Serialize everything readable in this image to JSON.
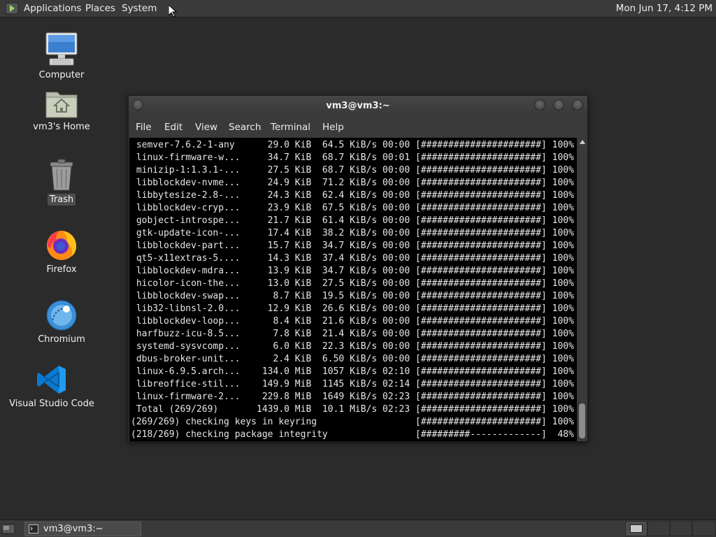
{
  "top_panel": {
    "menus": [
      "Applications",
      "Places",
      "System"
    ],
    "clock": "Mon Jun 17,  4:12 PM"
  },
  "desktop_icons": [
    {
      "label": "Computer"
    },
    {
      "label": "vm3's Home"
    },
    {
      "label": "Trash"
    },
    {
      "label": "Firefox"
    },
    {
      "label": "Chromium"
    },
    {
      "label": "Visual Studio Code"
    }
  ],
  "terminal": {
    "title": "vm3@vm3:~",
    "menu": [
      "File",
      "Edit",
      "View",
      "Search",
      "Terminal",
      "Help"
    ],
    "lines": [
      " semver-7.6.2-1-any      29.0 KiB  64.5 KiB/s 00:00 [######################] 100%",
      " linux-firmware-w...     34.7 KiB  68.7 KiB/s 00:01 [######################] 100%",
      " minizip-1:1.3.1-...     27.5 KiB  68.7 KiB/s 00:00 [######################] 100%",
      " libblockdev-nvme...     24.9 KiB  71.2 KiB/s 00:00 [######################] 100%",
      " libbytesize-2.8-...     24.3 KiB  62.4 KiB/s 00:00 [######################] 100%",
      " libblockdev-cryp...     23.9 KiB  67.5 KiB/s 00:00 [######################] 100%",
      " gobject-introspe...     21.7 KiB  61.4 KiB/s 00:00 [######################] 100%",
      " gtk-update-icon-...     17.4 KiB  38.2 KiB/s 00:00 [######################] 100%",
      " libblockdev-part...     15.7 KiB  34.7 KiB/s 00:00 [######################] 100%",
      " qt5-x11extras-5....     14.3 KiB  37.4 KiB/s 00:00 [######################] 100%",
      " libblockdev-mdra...     13.9 KiB  34.7 KiB/s 00:00 [######################] 100%",
      " hicolor-icon-the...     13.0 KiB  27.5 KiB/s 00:00 [######################] 100%",
      " libblockdev-swap...      8.7 KiB  19.5 KiB/s 00:00 [######################] 100%",
      " lib32-libnsl-2.0...     12.9 KiB  26.6 KiB/s 00:00 [######################] 100%",
      " libblockdev-loop...      8.4 KiB  21.6 KiB/s 00:00 [######################] 100%",
      " harfbuzz-icu-8.5...      7.8 KiB  21.4 KiB/s 00:00 [######################] 100%",
      " systemd-sysvcomp...      6.0 KiB  22.3 KiB/s 00:00 [######################] 100%",
      " dbus-broker-unit...      2.4 KiB  6.50 KiB/s 00:00 [######################] 100%",
      " linux-6.9.5.arch...    134.0 MiB  1057 KiB/s 02:10 [######################] 100%",
      " libreoffice-stil...    149.9 MiB  1145 KiB/s 02:14 [######################] 100%",
      " linux-firmware-2...    229.8 MiB  1649 KiB/s 02:23 [######################] 100%",
      " Total (269/269)       1439.0 MiB  10.1 MiB/s 02:23 [######################] 100%",
      "(269/269) checking keys in keyring                  [######################] 100%",
      "(218/269) checking package integrity                [#########-------------]  48%"
    ]
  },
  "bottom_panel": {
    "taskbar_window": "vm3@vm3:~"
  }
}
